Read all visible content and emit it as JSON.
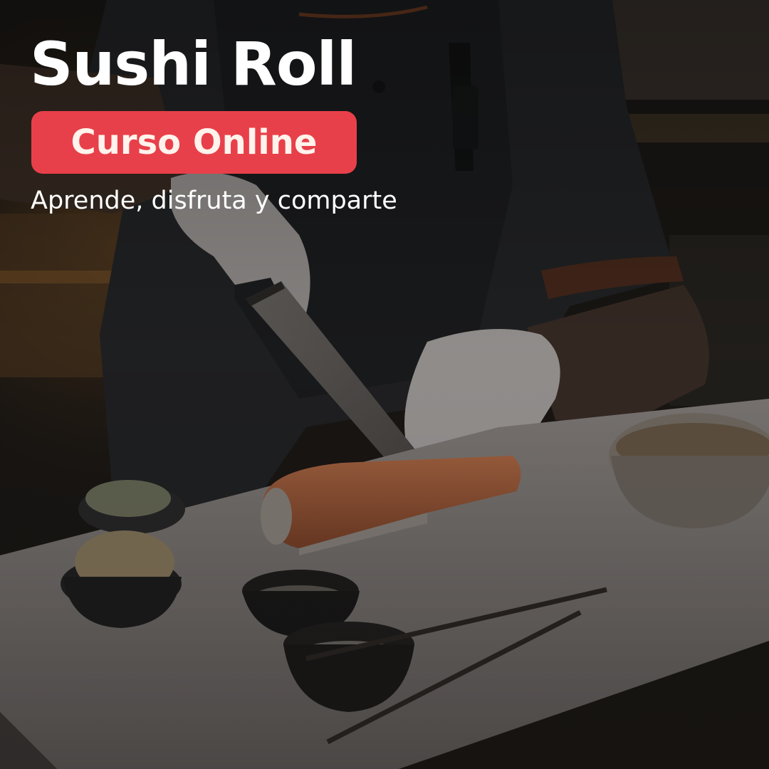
{
  "headline": {
    "title": "Sushi Roll",
    "badge": "Curso Online",
    "tagline": "Aprende, disfruta y comparte"
  },
  "colors": {
    "badge_background": "#e8404a",
    "title_text": "#ffffff",
    "background": "#141210"
  },
  "photo": {
    "icon": "chef-slicing-sushi-roll-photo"
  }
}
